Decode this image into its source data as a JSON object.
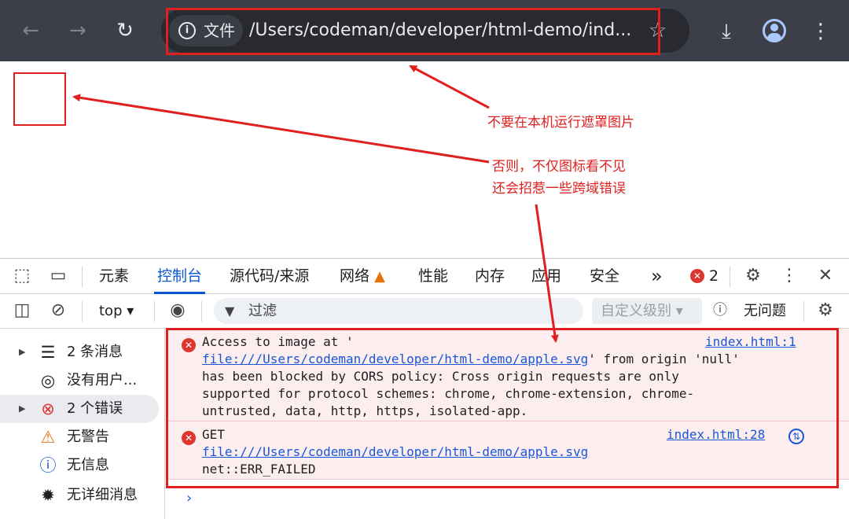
{
  "browser": {
    "site_chip": "文件",
    "url": "/Users/codeman/developer/html-demo/ind..."
  },
  "annotations": {
    "note1": "不要在本机运行遮罩图片",
    "note2_line1": "否则，不仅图标看不见",
    "note2_line2": "还会招惹一些跨域错误"
  },
  "devtools": {
    "tabs": [
      "元素",
      "控制台",
      "源代码/来源",
      "网络",
      "性能",
      "内存",
      "应用",
      "安全"
    ],
    "error_badge_count": "2",
    "more_tabs": "»",
    "console_toolbar": {
      "context": "top ▾",
      "filter_placeholder": "过滤",
      "levels": "自定义级别 ▾",
      "issues": "无问题"
    },
    "sidebar": [
      {
        "label": "2 条消息",
        "icon": "list-icon"
      },
      {
        "label": "没有用户...",
        "icon": "user-icon"
      },
      {
        "label": "2 个错误",
        "icon": "error-icon"
      },
      {
        "label": "无警告",
        "icon": "warning-icon"
      },
      {
        "label": "无信息",
        "icon": "info-icon"
      },
      {
        "label": "无详细消息",
        "icon": "bug-icon"
      }
    ],
    "messages": [
      {
        "line1": "Access to image at '",
        "url": "file:///Users/codeman/developer/html-demo/apple.svg",
        "after_url": "' from origin 'null'",
        "line3": "has been blocked by CORS policy: Cross origin requests are only",
        "line4": "supported for protocol schemes: chrome, chrome-extension, chrome-",
        "line5": "untrusted, data, http, https, isolated-app.",
        "source": "index.html:1"
      },
      {
        "line1": "GET",
        "url": "file:///Users/codeman/developer/html-demo/apple.svg",
        "line3": "net::ERR_FAILED",
        "source": "index.html:28"
      }
    ],
    "prompt": "›"
  },
  "colors": {
    "annotation_red": "#e02020",
    "accent_blue": "#0b57d0",
    "error_red": "#dc362e",
    "toolbar_bg": "#3c3f4a"
  }
}
